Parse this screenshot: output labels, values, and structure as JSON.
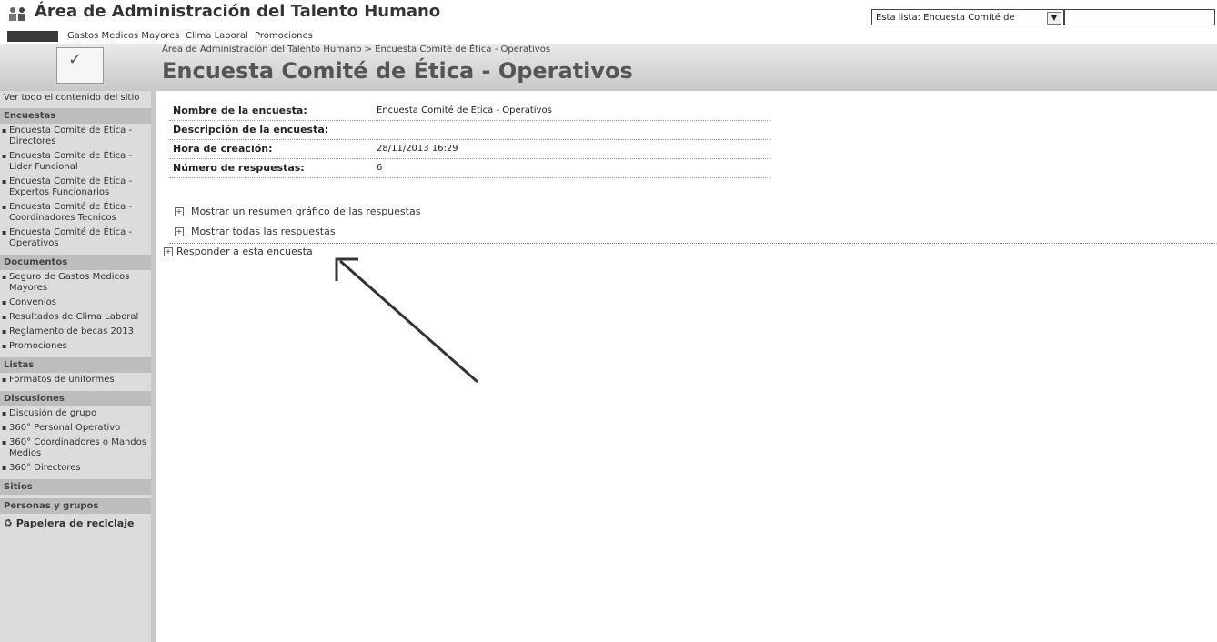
{
  "site": {
    "title": "Área de Administración del Talento Humano"
  },
  "search": {
    "scope_label": "Esta lista: Encuesta Comité de"
  },
  "tabs": [
    "Gastos Medicos Mayores",
    "Clima Laboral",
    "Promociones"
  ],
  "breadcrumb": "Área de Administración del Talento Humano > Encuesta Comité de Ética - Operativos",
  "page_title": "Encuesta Comité de Ética - Operativos",
  "quicklaunch": {
    "view_all": "Ver todo el contenido del sitio",
    "sections": [
      {
        "header": "Encuestas",
        "items": [
          "Encuesta Comite de Ética - Directores",
          "Encuesta Comite de Ética - Lider Funcional",
          "Encuesta Comite de Ética - Expertos Funcionarios",
          "Encuesta Comité de Ética - Coordinadores Tecnicos",
          "Encuesta Comité de Ética - Operativos"
        ]
      },
      {
        "header": "Documentos",
        "items": [
          "Seguro de Gastos Medicos Mayores",
          "Convenios",
          "Resultados de Clima Laboral",
          "Reglamento de becas 2013",
          "Promociones"
        ]
      },
      {
        "header": "Listas",
        "items": [
          "Formatos de uniformes"
        ]
      },
      {
        "header": "Discusiones",
        "items": [
          "Discusión de grupo",
          "360° Personal Operativo",
          "360° Coordinadores o Mandos Medios",
          "360° Directores"
        ]
      }
    ],
    "sites": "Sitios",
    "people": "Personas y grupos",
    "recycle": "Papelera de reciclaje"
  },
  "survey": {
    "rows": [
      {
        "label": "Nombre de la encuesta:",
        "value": "Encuesta Comité de Ética - Operativos"
      },
      {
        "label": "Descripción de la encuesta:",
        "value": ""
      },
      {
        "label": "Hora de creación:",
        "value": "28/11/2013 16:29"
      },
      {
        "label": "Número de respuestas:",
        "value": "6"
      }
    ]
  },
  "actions": {
    "graphic_summary": "Mostrar un resumen gráfico de las respuestas",
    "all_responses": "Mostrar todas las respuestas",
    "respond": "Responder a esta encuesta"
  }
}
